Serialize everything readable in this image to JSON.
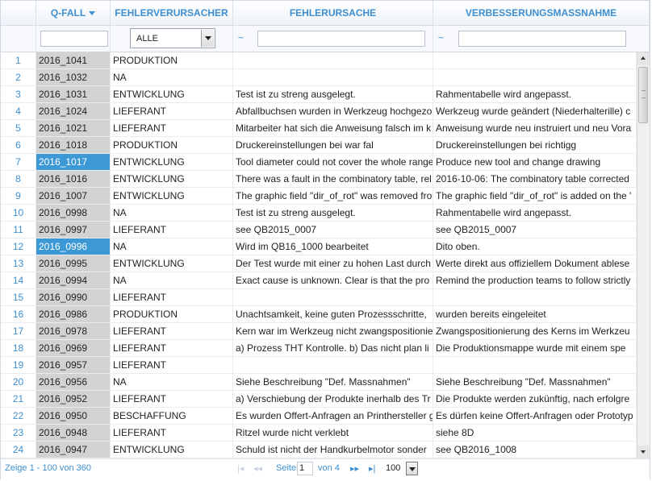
{
  "columns": [
    {
      "key": "rn",
      "label": ""
    },
    {
      "key": "qfall",
      "label": "Q-FALL"
    },
    {
      "key": "fehlerverursacher",
      "label": "FEHLERVERURSACHER"
    },
    {
      "key": "fehlerursache",
      "label": "FEHLERURSACHE"
    },
    {
      "key": "verbesserungsmassnahme",
      "label": "VERBESSERUNGSMASSNAHME"
    }
  ],
  "filters": {
    "qfall_value": "",
    "verursacher_selected": "ALLE",
    "tilde": "~",
    "ursache_value": "",
    "massnahme_value": ""
  },
  "rows": [
    {
      "rn": "1",
      "qfall": "2016_1041",
      "fv": "PRODUKTION",
      "fu": "",
      "vm": ""
    },
    {
      "rn": "2",
      "qfall": "2016_1032",
      "fv": "NA",
      "fu": "",
      "vm": ""
    },
    {
      "rn": "3",
      "qfall": "2016_1031",
      "fv": "ENTWICKLUNG",
      "fu": "Test ist zu streng ausgelegt.",
      "vm": "Rahmentabelle wird angepasst."
    },
    {
      "rn": "4",
      "qfall": "2016_1024",
      "fv": "LIEFERANT",
      "fu": "Abfallbuchsen wurden in Werkzeug hochgezo",
      "vm": "Werkzeug wurde geändert (Niederhalterille) c"
    },
    {
      "rn": "5",
      "qfall": "2016_1021",
      "fv": "LIEFERANT",
      "fu": "Mitarbeiter hat sich die Anweisung falsch im k",
      "vm": "Anweisung wurde neu instruiert und neu Vora"
    },
    {
      "rn": "6",
      "qfall": "2016_1018",
      "fv": "PRODUKTION",
      "fu": "Druckereinstellungen bei                    war fal",
      "vm": "Druckereinstellungen bei                    richtigg"
    },
    {
      "rn": "7",
      "qfall": "2016_1017",
      "fv": "ENTWICKLUNG",
      "fu": "Tool diameter could not cover the whole range",
      "vm": "Produce new tool and change drawing",
      "selected": true
    },
    {
      "rn": "8",
      "qfall": "2016_1016",
      "fv": "ENTWICKLUNG",
      "fu": "There was a fault in the combinatory table, rel",
      "vm": "2016-10-06: The combinatory table corrected"
    },
    {
      "rn": "9",
      "qfall": "2016_1007",
      "fv": "ENTWICKLUNG",
      "fu": "The graphic field \"dir_of_rot\" was removed fro",
      "vm": "The graphic field \"dir_of_rot\" is added on the '"
    },
    {
      "rn": "10",
      "qfall": "2016_0998",
      "fv": "NA",
      "fu": "Test ist zu streng ausgelegt.",
      "vm": "Rahmentabelle wird angepasst."
    },
    {
      "rn": "11",
      "qfall": "2016_0997",
      "fv": "LIEFERANT",
      "fu": "see QB2015_0007",
      "vm": "see QB2015_0007"
    },
    {
      "rn": "12",
      "qfall": "2016_0996",
      "fv": "NA",
      "fu": "Wird im QB16_1000 bearbeitet",
      "vm": "Dito oben.",
      "selected": true
    },
    {
      "rn": "13",
      "qfall": "2016_0995",
      "fv": "ENTWICKLUNG",
      "fu": "Der Test wurde mit einer zu hohen Last durch",
      "vm": "Werte direkt aus offiziellem Dokument ablese"
    },
    {
      "rn": "14",
      "qfall": "2016_0994",
      "fv": "NA",
      "fu": "Exact cause is unknown. Clear is that the pro",
      "vm": "Remind the production teams to follow strictly"
    },
    {
      "rn": "15",
      "qfall": "2016_0990",
      "fv": "LIEFERANT",
      "fu": "",
      "vm": ""
    },
    {
      "rn": "16",
      "qfall": "2016_0986",
      "fv": "PRODUKTION",
      "fu": "Unachtsamkeit, keine guten Prozessschritte,",
      "vm": "wurden bereits eingeleitet"
    },
    {
      "rn": "17",
      "qfall": "2016_0978",
      "fv": "LIEFERANT",
      "fu": "Kern war im Werkzeug nicht zwangspositionie",
      "vm": "Zwangspositionierung des Kerns im Werkzeu"
    },
    {
      "rn": "18",
      "qfall": "2016_0969",
      "fv": "LIEFERANT",
      "fu": "a) Prozess THT Kontrolle. b) Das nicht plan li",
      "vm": "Die Produktionsmappe wurde mit einem spe"
    },
    {
      "rn": "19",
      "qfall": "2016_0957",
      "fv": "LIEFERANT",
      "fu": "",
      "vm": ""
    },
    {
      "rn": "20",
      "qfall": "2016_0956",
      "fv": "NA",
      "fu": "Siehe Beschreibung \"Def. Massnahmen\"",
      "vm": "Siehe Beschreibung \"Def. Massnahmen\""
    },
    {
      "rn": "21",
      "qfall": "2016_0952",
      "fv": "LIEFERANT",
      "fu": "a) Verschiebung der Produkte inerhalb des Tr",
      "vm": "Die Produkte werden zukünftig, nach erfolgre"
    },
    {
      "rn": "22",
      "qfall": "2016_0950",
      "fv": "BESCHAFFUNG",
      "fu": "Es wurden Offert-Anfragen an Printhersteller g",
      "vm": "Es dürfen keine Offert-Anfragen oder Prototyp"
    },
    {
      "rn": "23",
      "qfall": "2016_0948",
      "fv": "LIEFERANT",
      "fu": "Ritzel wurde nicht verklebt",
      "vm": "siehe 8D"
    },
    {
      "rn": "24",
      "qfall": "2016_0947",
      "fv": "ENTWICKLUNG",
      "fu": "Schuld ist nicht der Handkurbelmotor sonder",
      "vm": "see QB2016_1008"
    }
  ],
  "pager": {
    "info": "Zeige 1 - 100 von 360",
    "page_label": "Seite",
    "page_value": "1",
    "of_label": "von 4",
    "first_icon": "first-page-icon",
    "prev_icon": "prev-page-icon",
    "next_icon": "next-page-icon",
    "last_icon": "last-page-icon",
    "page_size": "100",
    "first_glyph": "|◂",
    "prev_glyph": "◂◂",
    "next_glyph": "▸▸",
    "last_glyph": "▸|"
  }
}
